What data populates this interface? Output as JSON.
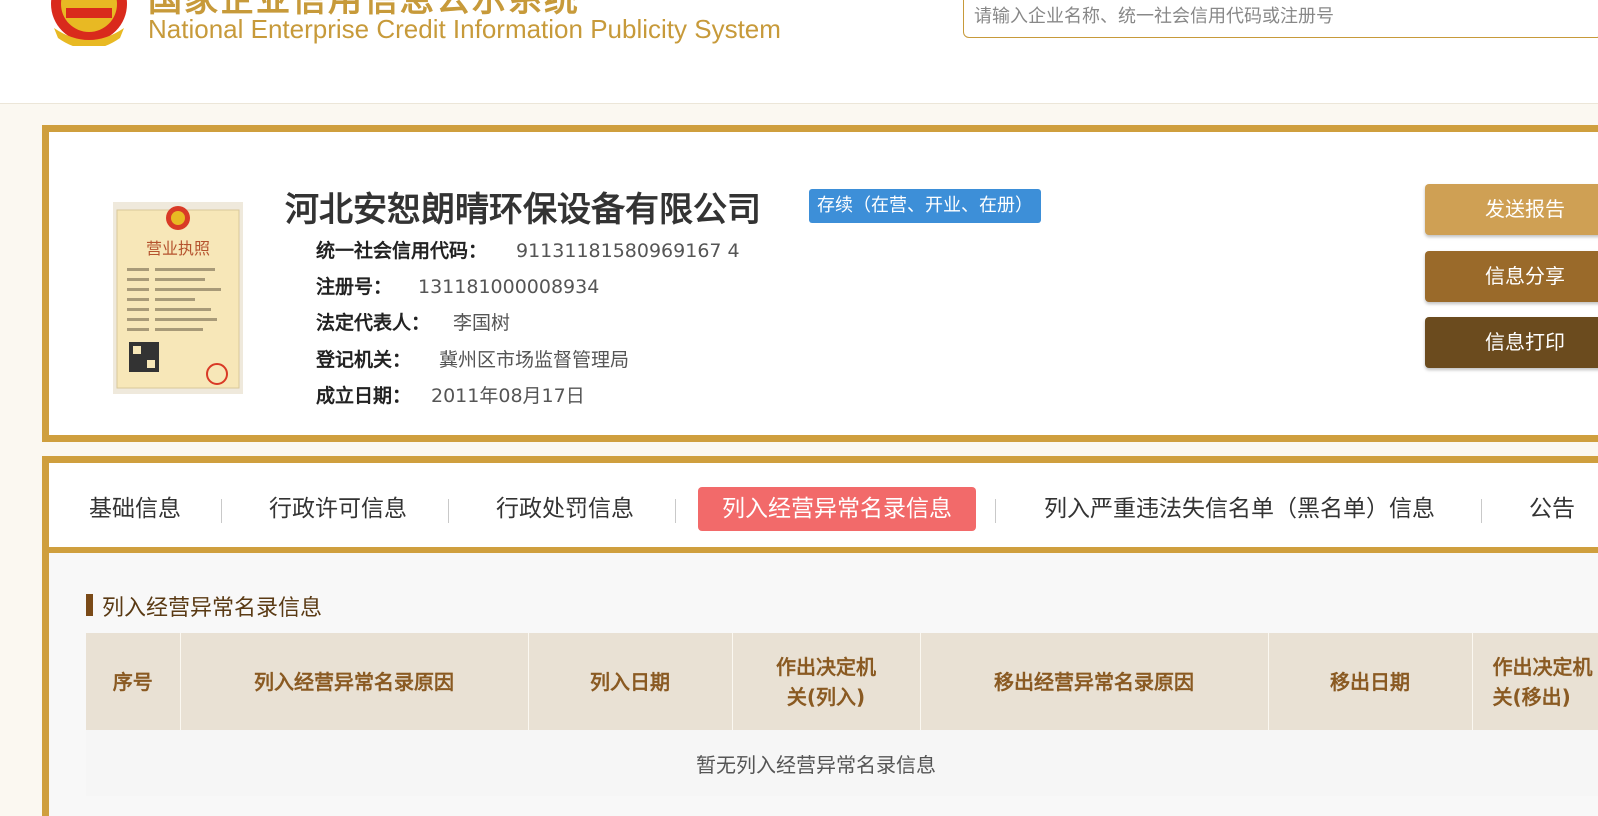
{
  "header": {
    "title_cn": "国家企业信用信息公示系统",
    "title_en": "National Enterprise Credit Information Publicity System",
    "search_placeholder": "请输入企业名称、统一社会信用代码或注册号"
  },
  "company": {
    "name": "河北安恕朗晴环保设备有限公司",
    "status": "存续（在营、开业、在册）",
    "fields": [
      {
        "label": "统一社会信用代码：",
        "value": "91131181580969167 4"
      },
      {
        "label": "注册号：",
        "value": "131181000008934"
      },
      {
        "label": "法定代表人：",
        "value": "李国树"
      },
      {
        "label": "登记机关：",
        "value": "冀州区市场监督管理局"
      },
      {
        "label": "成立日期：",
        "value": "2011年08月17日"
      }
    ],
    "license_text": "营业执照"
  },
  "actions": {
    "send_report": "发送报告",
    "share_info": "信息分享",
    "print_info": "信息打印"
  },
  "tabs": [
    {
      "label": "基础信息"
    },
    {
      "label": "行政许可信息"
    },
    {
      "label": "行政处罚信息"
    },
    {
      "label": "列入经营异常名录信息"
    },
    {
      "label": "列入严重违法失信名单（黑名单）信息"
    },
    {
      "label": "公告"
    }
  ],
  "section": {
    "title": "列入经营异常名录信息",
    "columns": [
      "序号",
      "列入经营异常名录原因",
      "列入日期",
      "作出决定机关(列入)",
      "移出经营异常名录原因",
      "移出日期",
      "作出决定机关(移出)"
    ],
    "empty_text": "暂无列入经营异常名录信息"
  },
  "colors": {
    "gold": "#cf9f3e",
    "badge_blue": "#3d8fd8",
    "active_tab": "#f26a6a",
    "btn1": "#cfa054",
    "btn2": "#9a6a2a",
    "btn3": "#6b4b1e"
  }
}
